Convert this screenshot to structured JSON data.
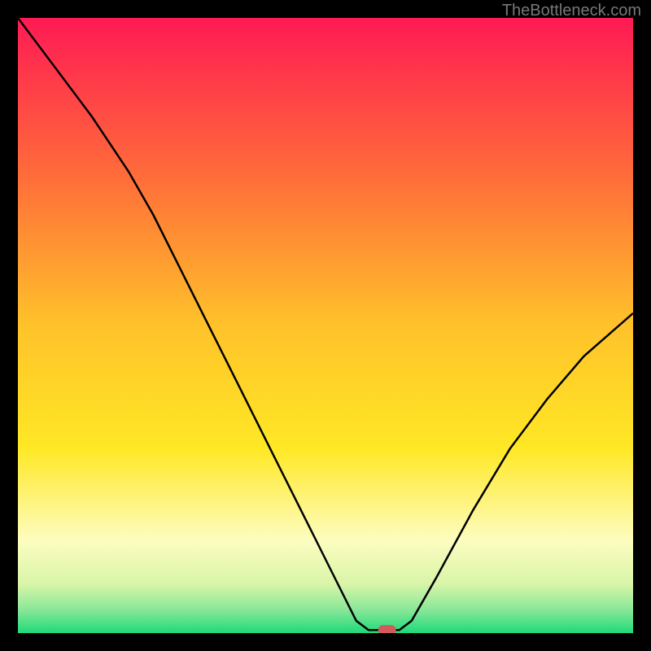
{
  "watermark": "TheBottleneck.com",
  "chart_data": {
    "type": "line",
    "title": "",
    "xlabel": "",
    "ylabel": "",
    "xlim": [
      0,
      100
    ],
    "ylim": [
      0,
      100
    ],
    "curve": [
      {
        "x": 0,
        "y": 100
      },
      {
        "x": 6,
        "y": 92
      },
      {
        "x": 12,
        "y": 84
      },
      {
        "x": 18,
        "y": 75
      },
      {
        "x": 22,
        "y": 68
      },
      {
        "x": 26,
        "y": 60
      },
      {
        "x": 30,
        "y": 52
      },
      {
        "x": 36,
        "y": 40
      },
      {
        "x": 42,
        "y": 28
      },
      {
        "x": 48,
        "y": 16
      },
      {
        "x": 52,
        "y": 8
      },
      {
        "x": 55,
        "y": 2
      },
      {
        "x": 57,
        "y": 0.5
      },
      {
        "x": 60,
        "y": 0.5
      },
      {
        "x": 62,
        "y": 0.5
      },
      {
        "x": 64,
        "y": 2
      },
      {
        "x": 68,
        "y": 9
      },
      {
        "x": 74,
        "y": 20
      },
      {
        "x": 80,
        "y": 30
      },
      {
        "x": 86,
        "y": 38
      },
      {
        "x": 92,
        "y": 45
      },
      {
        "x": 100,
        "y": 52
      }
    ],
    "marker": {
      "x": 60,
      "y": 0.5
    },
    "gradient_stops": [
      {
        "offset": 0,
        "color": "#ff1a54"
      },
      {
        "offset": 25,
        "color": "#ff6a3a"
      },
      {
        "offset": 50,
        "color": "#ffc22a"
      },
      {
        "offset": 70,
        "color": "#ffe825"
      },
      {
        "offset": 85,
        "color": "#fdfdc0"
      },
      {
        "offset": 92,
        "color": "#d8f5a8"
      },
      {
        "offset": 96,
        "color": "#8ee89a"
      },
      {
        "offset": 100,
        "color": "#1fd97a"
      }
    ],
    "marker_color": "#d15a5a",
    "curve_color": "#000000"
  }
}
